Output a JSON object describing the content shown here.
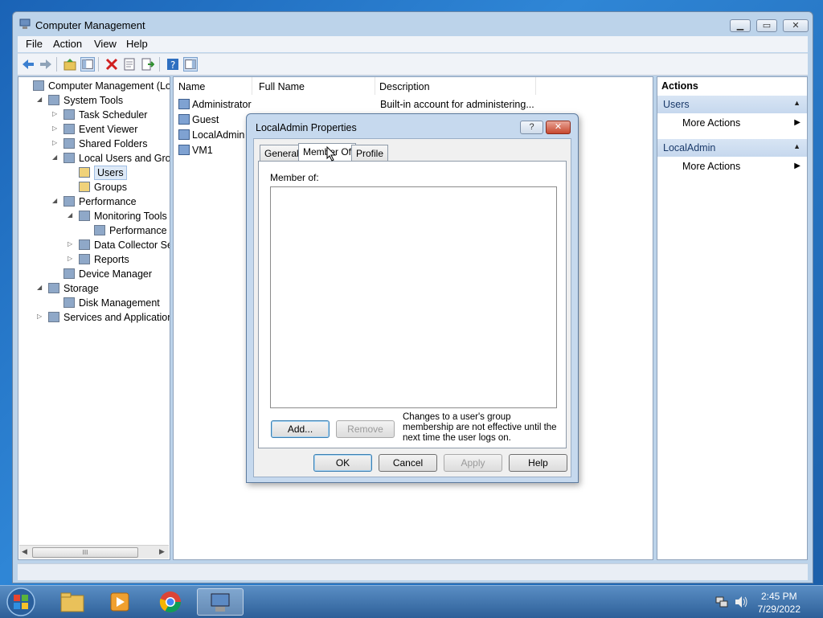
{
  "window": {
    "title": "Computer Management",
    "min_label": "▁",
    "max_label": "▭",
    "close_label": "✕"
  },
  "menu": [
    "File",
    "Action",
    "View",
    "Help"
  ],
  "tree": {
    "items": [
      {
        "label": "Computer Management (Local",
        "indent": 0,
        "expander": "",
        "icon": "computer-management-icon"
      },
      {
        "label": "System Tools",
        "indent": 1,
        "expander": "◢",
        "icon": "system-tools-icon"
      },
      {
        "label": "Task Scheduler",
        "indent": 2,
        "expander": "▷",
        "icon": "clock-icon"
      },
      {
        "label": "Event Viewer",
        "indent": 2,
        "expander": "▷",
        "icon": "event-viewer-icon"
      },
      {
        "label": "Shared Folders",
        "indent": 2,
        "expander": "▷",
        "icon": "shared-folder-icon"
      },
      {
        "label": "Local Users and Groups",
        "indent": 2,
        "expander": "◢",
        "icon": "users-groups-icon"
      },
      {
        "label": "Users",
        "indent": 3,
        "expander": "",
        "icon": "folder-icon",
        "selected": true
      },
      {
        "label": "Groups",
        "indent": 3,
        "expander": "",
        "icon": "folder-icon"
      },
      {
        "label": "Performance",
        "indent": 2,
        "expander": "◢",
        "icon": "performance-icon"
      },
      {
        "label": "Monitoring Tools",
        "indent": 3,
        "expander": "◢",
        "icon": "monitoring-tools-icon"
      },
      {
        "label": "Performance Mo",
        "indent": 4,
        "expander": "",
        "icon": "performance-monitor-icon"
      },
      {
        "label": "Data Collector Sets",
        "indent": 3,
        "expander": "▷",
        "icon": "data-collector-icon"
      },
      {
        "label": "Reports",
        "indent": 3,
        "expander": "▷",
        "icon": "reports-icon"
      },
      {
        "label": "Device Manager",
        "indent": 2,
        "expander": "",
        "icon": "device-manager-icon"
      },
      {
        "label": "Storage",
        "indent": 1,
        "expander": "◢",
        "icon": "storage-icon"
      },
      {
        "label": "Disk Management",
        "indent": 2,
        "expander": "",
        "icon": "disk-management-icon"
      },
      {
        "label": "Services and Applications",
        "indent": 1,
        "expander": "▷",
        "icon": "services-icon"
      }
    ],
    "scroll_grip": "III"
  },
  "list": {
    "columns": [
      "Name",
      "Full Name",
      "Description"
    ],
    "rows": [
      {
        "name": "Administrator",
        "full_name": "",
        "description": "Built-in account for administering..."
      },
      {
        "name": "Guest",
        "full_name": "",
        "description": ""
      },
      {
        "name": "LocalAdmin",
        "full_name": "",
        "description": ""
      },
      {
        "name": "VM1",
        "full_name": "",
        "description": ""
      }
    ]
  },
  "actions": {
    "header": "Actions",
    "sections": [
      {
        "title": "Users",
        "items": [
          "More Actions"
        ]
      },
      {
        "title": "LocalAdmin",
        "items": [
          "More Actions"
        ]
      }
    ]
  },
  "dialog": {
    "title": "LocalAdmin Properties",
    "help_label": "?",
    "close_label": "✕",
    "tabs": [
      "General",
      "Member Of",
      "Profile"
    ],
    "active_tab": "Member Of",
    "member_of_label": "Member of:",
    "add_label": "Add...",
    "remove_label": "Remove",
    "note": "Changes to a user's group membership are not effective until the next time the user logs on.",
    "ok_label": "OK",
    "cancel_label": "Cancel",
    "apply_label": "Apply",
    "help_button_label": "Help"
  },
  "taskbar": {
    "time": "2:45 PM",
    "date": "7/29/2022"
  }
}
